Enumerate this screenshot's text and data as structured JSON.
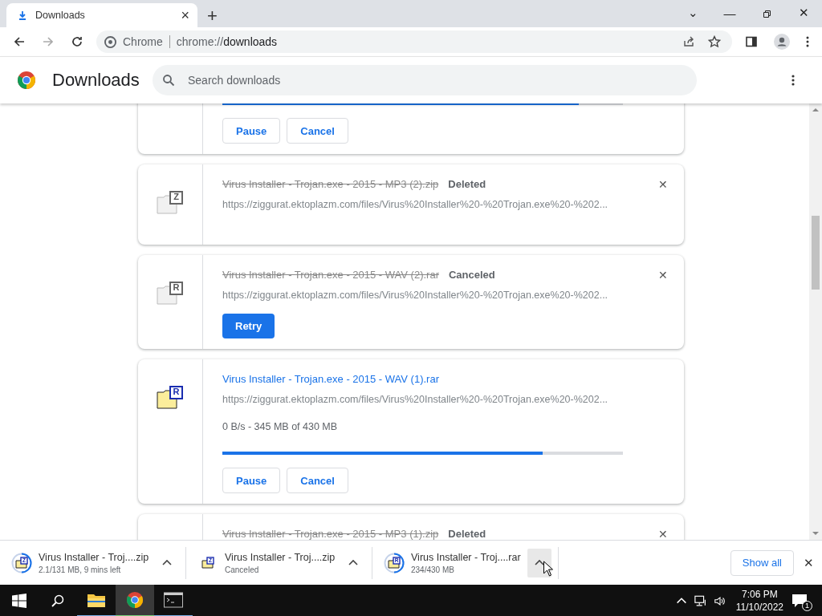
{
  "tab": {
    "title": "Downloads",
    "close": "×",
    "new_tab": "+"
  },
  "window_controls": {
    "tab_search": "⌄",
    "minimize": "—",
    "close": "✕"
  },
  "toolbar": {
    "site_label": "Chrome",
    "url_scheme": "chrome://",
    "url_host": "downloads"
  },
  "page_header": {
    "title": "Downloads",
    "search": {
      "placeholder": "Search downloads"
    }
  },
  "downloads": [
    {
      "kind": "partial",
      "level": 0.89,
      "buttons": [
        {
          "label": "Pause",
          "primary": false
        },
        {
          "label": "Cancel",
          "primary": false
        }
      ]
    },
    {
      "kind": "item",
      "icon_letter": "Z",
      "removed": true,
      "name": "Virus Installer - Trojan.exe - 2015 - MP3 (2).zip",
      "status": "Deleted",
      "url": "https://ziggurat.ektoplazm.com/files/Virus%20Installer%20-%20Trojan.exe%20-%202...",
      "remove": "✕"
    },
    {
      "kind": "item",
      "icon_letter": "R",
      "removed": true,
      "name": "Virus Installer - Trojan.exe - 2015 - WAV (2).rar",
      "status": "Canceled",
      "url": "https://ziggurat.ektoplazm.com/files/Virus%20Installer%20-%20Trojan.exe%20-%202...",
      "remove": "✕",
      "buttons": [
        {
          "label": "Retry",
          "primary": true
        }
      ]
    },
    {
      "kind": "item",
      "icon_letter": "R",
      "removed": false,
      "name": "Virus Installer - Trojan.exe - 2015 - WAV (1).rar",
      "url": "https://ziggurat.ektoplazm.com/files/Virus%20Installer%20-%20Trojan.exe%20-%202...",
      "progress_text": "0 B/s - 345 MB of 430 MB",
      "level": 0.8,
      "buttons": [
        {
          "label": "Pause",
          "primary": false
        },
        {
          "label": "Cancel",
          "primary": false
        }
      ]
    },
    {
      "kind": "item",
      "removed": true,
      "name": "Virus Installer - Trojan.exe - 2015 - MP3 (1).zip",
      "status": "Deleted",
      "remove": "✕"
    }
  ],
  "shelf": {
    "items": [
      {
        "icon_letter": "Z",
        "ring": true,
        "name": "Virus Installer - Troj....zip",
        "detail": "2.1/131 MB, 9 mins left",
        "caret_hovered": false
      },
      {
        "icon_letter": "Z",
        "ring": false,
        "name": "Virus Installer - Troj....zip",
        "detail": "Canceled",
        "caret_hovered": false
      },
      {
        "icon_letter": "R",
        "ring": true,
        "name": "Virus Installer - Troj....rar",
        "detail": "234/430 MB",
        "caret_hovered": true
      }
    ],
    "show_all": "Show all",
    "close": "✕"
  },
  "taskbar": {
    "apps": [
      {
        "kind": "folder",
        "selected": false
      },
      {
        "kind": "chrome",
        "selected": true
      },
      {
        "kind": "terminal",
        "selected": false
      }
    ],
    "time": "7:06 PM",
    "date": "11/10/2022",
    "notifications": "1"
  }
}
